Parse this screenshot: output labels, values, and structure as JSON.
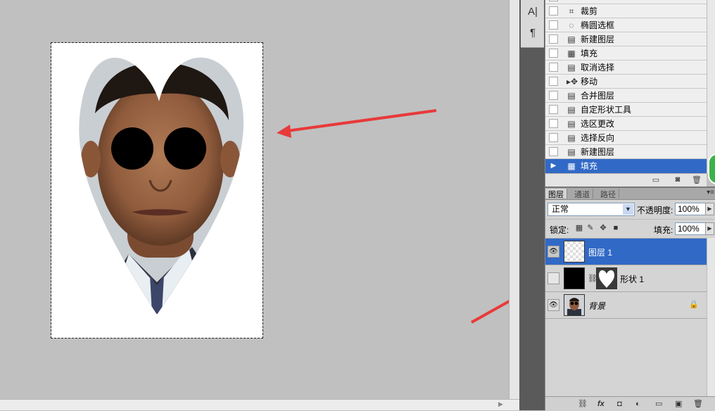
{
  "tools": [
    {
      "icon": "character-panel-icon",
      "glyph": "A|"
    },
    {
      "icon": "paragraph-icon",
      "glyph": "¶"
    }
  ],
  "history": {
    "items": [
      {
        "label": "裁剪",
        "icon": "crop-icon",
        "glyph": "⌗"
      },
      {
        "label": "椭圆选框",
        "icon": "elliptical-marquee-icon",
        "glyph": "◌"
      },
      {
        "label": "新建图层",
        "icon": "history-state-icon",
        "glyph": "▤"
      },
      {
        "label": "填充",
        "icon": "fill-icon",
        "glyph": "▦"
      },
      {
        "label": "取消选择",
        "icon": "history-state-icon",
        "glyph": "▤"
      },
      {
        "label": "移动",
        "icon": "move-icon",
        "glyph": "▸✥"
      },
      {
        "label": "合并图层",
        "icon": "history-state-icon",
        "glyph": "▤"
      },
      {
        "label": "自定形状工具",
        "icon": "history-state-icon",
        "glyph": "▤"
      },
      {
        "label": "选区更改",
        "icon": "history-state-icon",
        "glyph": "▤"
      },
      {
        "label": "选择反向",
        "icon": "history-state-icon",
        "glyph": "▤"
      },
      {
        "label": "新建图层",
        "icon": "history-state-icon",
        "glyph": "▤"
      },
      {
        "label": "填充",
        "icon": "fill-icon",
        "glyph": "▦",
        "active": true
      }
    ],
    "bottom_icons": [
      "new-document-from-state-icon",
      "camera-snapshot-icon",
      "trash-icon"
    ]
  },
  "layers_panel": {
    "tabs": [
      "图层",
      "通道",
      "路径"
    ],
    "blend_mode": "正常",
    "opacity_label": "不透明度:",
    "opacity_value": "100%",
    "lock_label": "锁定:",
    "fill_label": "填充:",
    "fill_value": "100%",
    "layers": [
      {
        "name": "图层 1",
        "visible": true,
        "active": true,
        "kind": "transparent"
      },
      {
        "name": "形状 1",
        "visible": false,
        "active": false,
        "kind": "shape"
      },
      {
        "name": "背景",
        "visible": true,
        "active": false,
        "kind": "photo",
        "locked": true
      }
    ],
    "bottom_icons": [
      "link-layers-icon",
      "fx-icon",
      "add-mask-icon",
      "adjustment-layer-icon",
      "group-folder-icon",
      "new-layer-icon",
      "trash-icon"
    ]
  },
  "colors": {
    "selection": "#3169c6",
    "arrow": "#e83a3a",
    "canvas_bg": "#c0c0c0"
  }
}
